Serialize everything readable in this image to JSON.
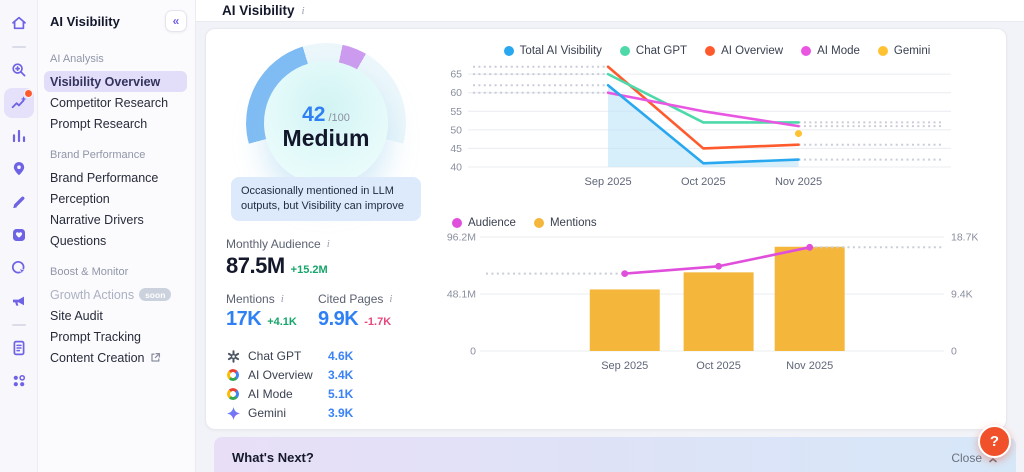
{
  "rail": {
    "icons": [
      {
        "name": "home-icon"
      },
      {
        "name": "divider"
      },
      {
        "name": "keyword-research-icon"
      },
      {
        "name": "ai-toolkit-icon",
        "selected": true,
        "notification": true
      },
      {
        "name": "analytics-icon"
      },
      {
        "name": "local-seo-icon"
      },
      {
        "name": "content-icon"
      },
      {
        "name": "social-media-icon"
      },
      {
        "name": "traffic-icon"
      },
      {
        "name": "advertising-icon"
      },
      {
        "name": "divider"
      },
      {
        "name": "reports-icon"
      },
      {
        "name": "apps-icon"
      }
    ]
  },
  "sidebar": {
    "title": "AI Visibility",
    "collapse_icon": "«",
    "items": [
      {
        "type": "section",
        "label": "AI Analysis"
      },
      {
        "type": "item",
        "label": "Visibility Overview",
        "selected": true
      },
      {
        "type": "item",
        "label": "Competitor Research"
      },
      {
        "type": "item",
        "label": "Prompt Research"
      },
      {
        "type": "section",
        "label": "Brand Performance"
      },
      {
        "type": "item",
        "label": "Brand Performance"
      },
      {
        "type": "item",
        "label": "Perception"
      },
      {
        "type": "item",
        "label": "Narrative Drivers"
      },
      {
        "type": "item",
        "label": "Questions"
      },
      {
        "type": "section",
        "label": "Boost & Monitor"
      },
      {
        "type": "item",
        "label": "Growth Actions",
        "disabled": true,
        "badge": "soon"
      },
      {
        "type": "item",
        "label": "Site Audit"
      },
      {
        "type": "item",
        "label": "Prompt Tracking"
      },
      {
        "type": "item",
        "label": "Content Creation",
        "external": true
      }
    ]
  },
  "header": {
    "title": "AI Visibility"
  },
  "gauge": {
    "score": "42",
    "max": "/100",
    "rating": "Medium",
    "note": "Occasionally mentioned in LLM outputs, but Visibility can improve"
  },
  "stats": {
    "monthly_audience": {
      "label": "Monthly Audience",
      "value": "87.5M",
      "delta": "+15.2M",
      "direction": "up"
    },
    "mentions": {
      "label": "Mentions",
      "value": "17K",
      "delta": "+4.1K",
      "direction": "up"
    },
    "cited_pages": {
      "label": "Cited Pages",
      "value": "9.9K",
      "delta": "-1.7K",
      "direction": "down"
    },
    "breakdown": [
      {
        "icon": "chatgpt-icon",
        "name": "Chat GPT",
        "value": "4.6K"
      },
      {
        "icon": "google-icon",
        "name": "AI Overview",
        "value": "3.4K"
      },
      {
        "icon": "google-icon",
        "name": "AI Mode",
        "value": "5.1K"
      },
      {
        "icon": "gemini-icon",
        "name": "Gemini",
        "value": "3.9K"
      }
    ]
  },
  "chart_data": [
    {
      "type": "line",
      "title": "AI Visibility trend",
      "categories": [
        "Sep 2025",
        "Oct 2025",
        "Nov 2025"
      ],
      "series": [
        {
          "name": "Total AI Visibility",
          "color": "#29A8F0",
          "values": [
            62,
            41,
            42
          ],
          "area": true
        },
        {
          "name": "Chat GPT",
          "color": "#4ED9A9",
          "values": [
            65,
            52,
            52
          ]
        },
        {
          "name": "AI Overview",
          "color": "#FF5A2D",
          "values": [
            67,
            45,
            46
          ]
        },
        {
          "name": "AI Mode",
          "color": "#E957E2",
          "values": [
            60,
            55,
            51
          ]
        },
        {
          "name": "Gemini",
          "color": "#FFC233",
          "values": [
            null,
            null,
            49
          ],
          "point_only": true
        }
      ],
      "ylim": [
        40,
        68
      ],
      "yticks": [
        40,
        45,
        50,
        55,
        60,
        65
      ],
      "grid": true,
      "legend_position": "top-center",
      "x_fractions": [
        0.287,
        0.485,
        0.683
      ],
      "draw_order": [
        2,
        1,
        3,
        0,
        4
      ],
      "dashed_extensions": true
    },
    {
      "type": "bar",
      "title": "Audience and Mentions",
      "categories": [
        "Sep 2025",
        "Oct 2025",
        "Nov 2025"
      ],
      "bar_series": {
        "name": "Mentions",
        "color": "#F5B63C",
        "values": [
          10100,
          12900,
          17100
        ],
        "axis": "right"
      },
      "line_series": {
        "name": "Audience",
        "color": "#E04FDC",
        "values": [
          65300000,
          71500000,
          87500000
        ],
        "axis": "left"
      },
      "left_axis": {
        "ticks": [
          "96.2M",
          "48.1M",
          "0"
        ],
        "max": 96200000
      },
      "right_axis": {
        "ticks": [
          "18.7K",
          "9.4K",
          "0"
        ],
        "max": 18700
      },
      "grid": true,
      "legend_position": "top-left",
      "x_fractions": [
        0.306,
        0.51,
        0.708
      ],
      "dashed_extensions": true
    }
  ],
  "whats_next": {
    "title": "What's Next?",
    "close_label": "Close"
  },
  "help": {
    "label": "?"
  }
}
